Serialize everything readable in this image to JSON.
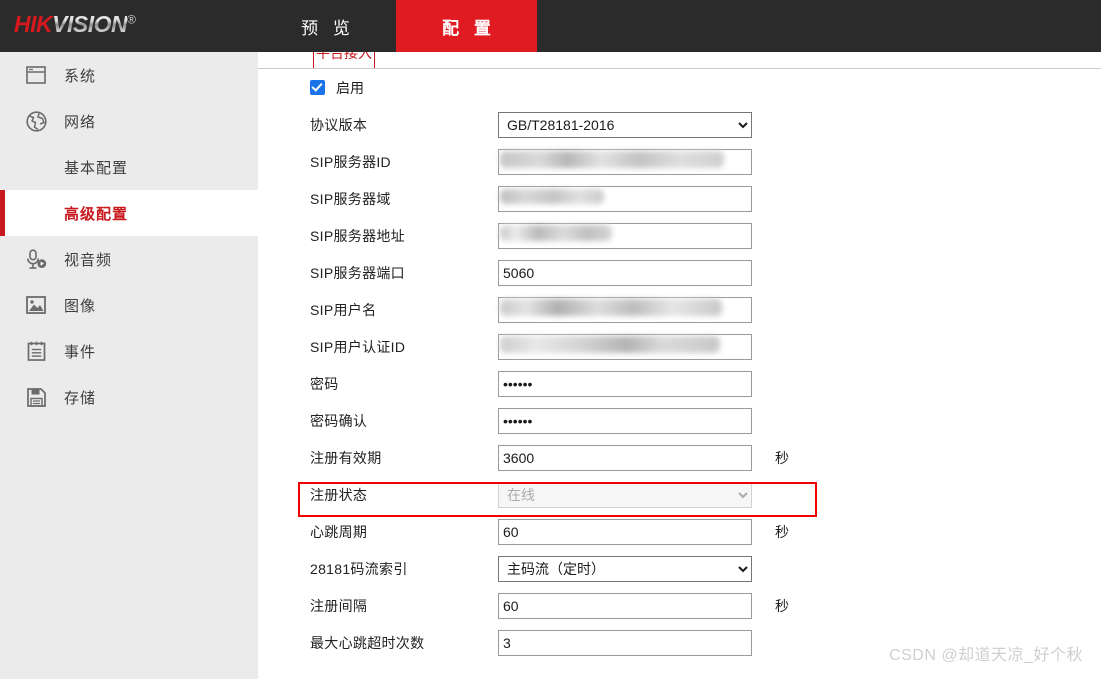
{
  "header": {
    "logo_hik": "HIK",
    "logo_vision": "VISION",
    "logo_reg": "®",
    "tabs": [
      {
        "label": "预 览",
        "active": false
      },
      {
        "label": "配 置",
        "active": true
      }
    ]
  },
  "sidebar": {
    "items": [
      {
        "label": "系统",
        "icon": "window-icon",
        "type": "top",
        "active": false
      },
      {
        "label": "网络",
        "icon": "globe-icon",
        "type": "top",
        "active": false
      },
      {
        "label": "基本配置",
        "icon": "",
        "type": "sub",
        "active": false
      },
      {
        "label": "高级配置",
        "icon": "",
        "type": "sub",
        "active": true
      },
      {
        "label": "视音频",
        "icon": "microphone-icon",
        "type": "top",
        "active": false
      },
      {
        "label": "图像",
        "icon": "image-icon",
        "type": "top",
        "active": false
      },
      {
        "label": "事件",
        "icon": "clipboard-icon",
        "type": "top",
        "active": false
      },
      {
        "label": "存储",
        "icon": "floppy-disk-icon",
        "type": "top",
        "active": false
      }
    ]
  },
  "content": {
    "subtab": {
      "label": "平台接入"
    },
    "enable": {
      "label": "启用",
      "checked": true
    },
    "fields": [
      {
        "label": "协议版本",
        "type": "select",
        "value": "GB/T28181-2016",
        "unit": "",
        "redacted": false,
        "disabled": false
      },
      {
        "label": "SIP服务器ID",
        "type": "text",
        "value": "",
        "unit": "",
        "redacted": true,
        "disabled": false
      },
      {
        "label": "SIP服务器域",
        "type": "text",
        "value": "",
        "unit": "",
        "redacted": true,
        "disabled": false
      },
      {
        "label": "SIP服务器地址",
        "type": "text",
        "value": "",
        "unit": "",
        "redacted": true,
        "disabled": false
      },
      {
        "label": "SIP服务器端口",
        "type": "text",
        "value": "5060",
        "unit": "",
        "redacted": false,
        "disabled": false
      },
      {
        "label": "SIP用户名",
        "type": "text",
        "value": "",
        "unit": "",
        "redacted": true,
        "disabled": false
      },
      {
        "label": "SIP用户认证ID",
        "type": "text",
        "value": "",
        "unit": "",
        "redacted": true,
        "disabled": false
      },
      {
        "label": "密码",
        "type": "password",
        "value": "••••••",
        "unit": "",
        "redacted": false,
        "disabled": false
      },
      {
        "label": "密码确认",
        "type": "password",
        "value": "••••••",
        "unit": "",
        "redacted": false,
        "disabled": false
      },
      {
        "label": "注册有效期",
        "type": "text",
        "value": "3600",
        "unit": "秒",
        "redacted": false,
        "disabled": false
      },
      {
        "label": "注册状态",
        "type": "select",
        "value": "在线",
        "unit": "",
        "redacted": false,
        "disabled": true
      },
      {
        "label": "心跳周期",
        "type": "text",
        "value": "60",
        "unit": "秒",
        "redacted": false,
        "disabled": false
      },
      {
        "label": "28181码流索引",
        "type": "select",
        "value": "主码流（定时）",
        "unit": "",
        "redacted": false,
        "disabled": false
      },
      {
        "label": "注册间隔",
        "type": "text",
        "value": "60",
        "unit": "秒",
        "redacted": false,
        "disabled": false
      },
      {
        "label": "最大心跳超时次数",
        "type": "text",
        "value": "3",
        "unit": "",
        "redacted": false,
        "disabled": false
      }
    ]
  },
  "watermark": {
    "text": "CSDN @却道天凉_好个秋"
  },
  "colors": {
    "brand_red": "#e11b22",
    "active_red": "#c8191f",
    "highlight_red": "#f10000",
    "header_dark": "#2b2b2b",
    "sidebar_grey": "#ebebeb",
    "checkbox_blue": "#1a73e8"
  }
}
